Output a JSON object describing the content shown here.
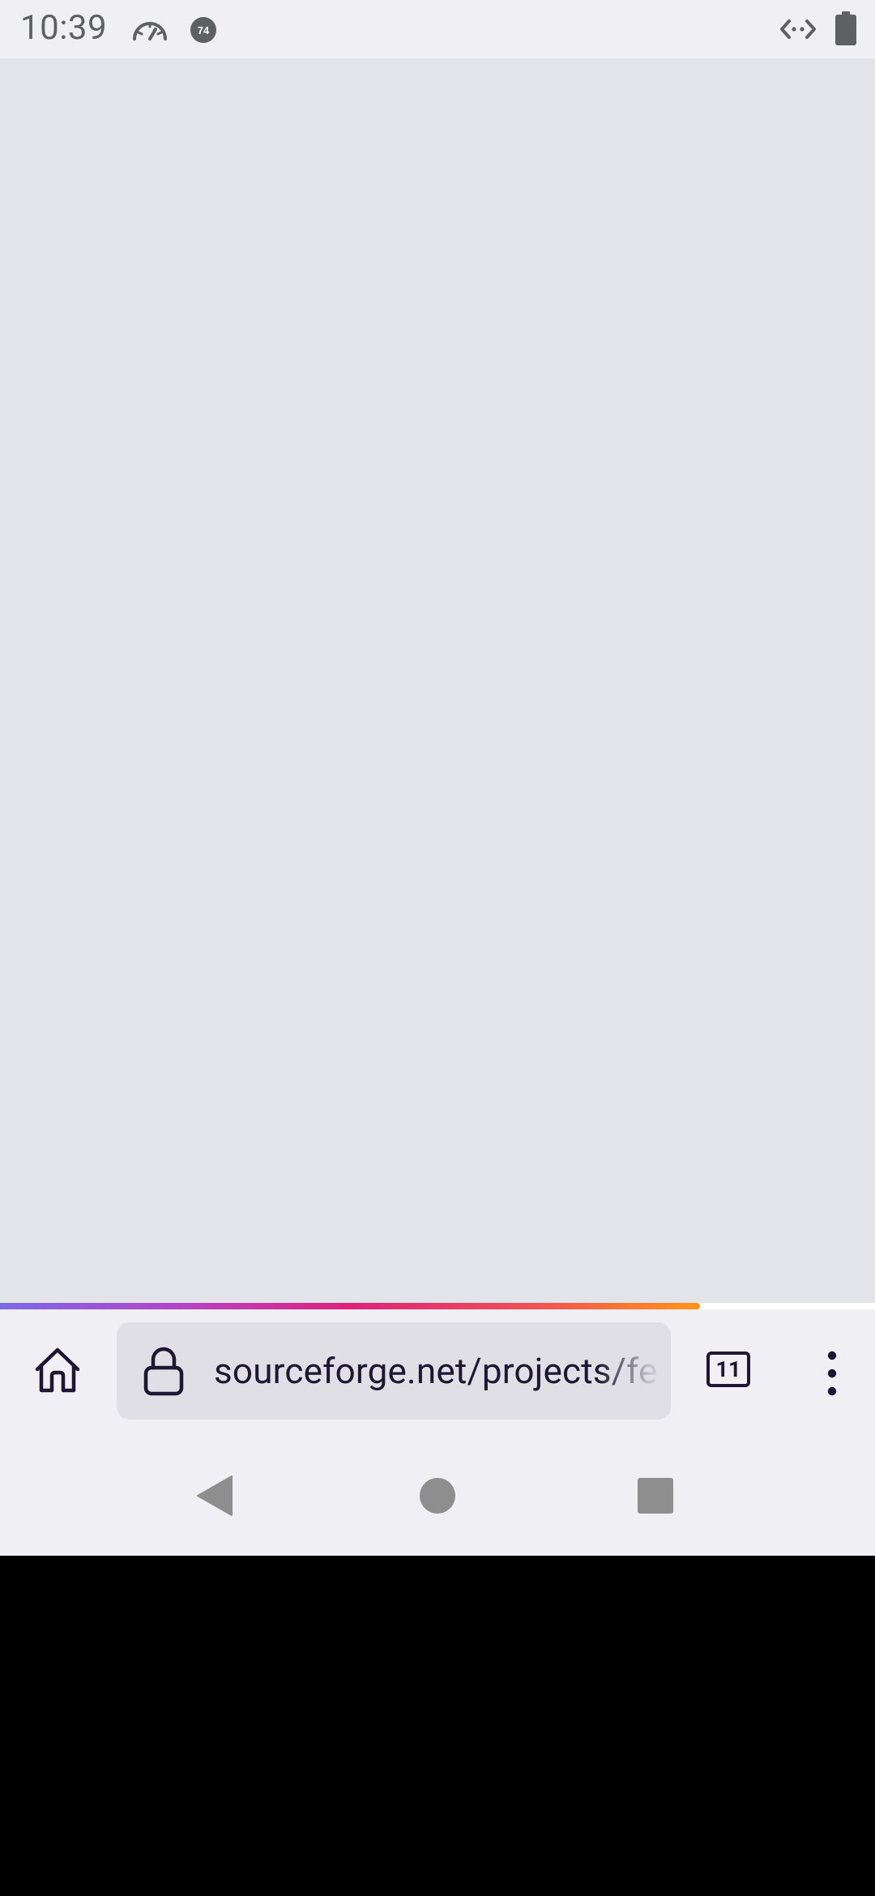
{
  "status_bar": {
    "time": "10:39",
    "icons": [
      "speedometer-icon",
      "notification-badge-icon",
      "data-sync-icon",
      "battery-icon"
    ],
    "notification_badge": "74"
  },
  "browser": {
    "url": "sourceforge.net/projects/fe",
    "tab_count": "11",
    "load_progress_percent": 80,
    "progress_gradient": [
      "#7b6ae8",
      "#b345c9",
      "#e0217a",
      "#f04e55",
      "#ff9419"
    ]
  },
  "toolbar": {
    "icons": [
      "home-icon",
      "lock-icon",
      "tab-counter",
      "more-options-icon"
    ]
  },
  "nav_bar": {
    "icons": [
      "back-icon",
      "home-circle-icon",
      "recents-icon"
    ]
  },
  "colors": {
    "status_bar_bg": "#f0eff4",
    "content_bg": "#e3e4e9",
    "toolbar_bg": "#f0eff4",
    "url_bar_bg": "#e0dfe6",
    "text_dark": "#1d1733"
  }
}
